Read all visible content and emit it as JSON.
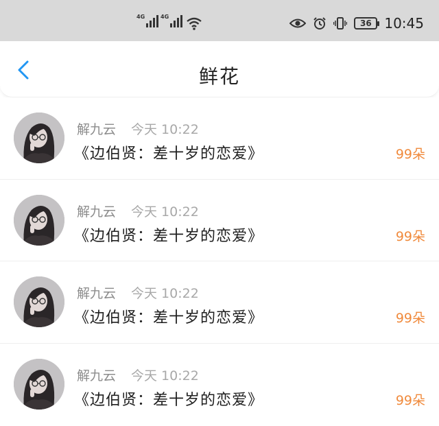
{
  "status_bar": {
    "signal1_tag": "4G",
    "signal2_tag": "4G",
    "battery": "36",
    "time": "10:45"
  },
  "header": {
    "title": "鲜花"
  },
  "items": [
    {
      "user": "解九云",
      "time": "今天 10:22",
      "book": "《边伯贤：差十岁的恋爱》",
      "count": "99朵"
    },
    {
      "user": "解九云",
      "time": "今天 10:22",
      "book": "《边伯贤：差十岁的恋爱》",
      "count": "99朵"
    },
    {
      "user": "解九云",
      "time": "今天 10:22",
      "book": "《边伯贤：差十岁的恋爱》",
      "count": "99朵"
    },
    {
      "user": "解九云",
      "time": "今天 10:22",
      "book": "《边伯贤：差十岁的恋爱》",
      "count": "99朵"
    }
  ],
  "colors": {
    "accent": "#2196f3",
    "count": "#f08a3c",
    "statusbar_bg": "#d9d9d9"
  },
  "icons": [
    "signal-icon",
    "wifi-icon",
    "eye-icon",
    "alarm-icon",
    "vibrate-icon",
    "battery-icon",
    "back-arrow-icon",
    "avatar"
  ]
}
